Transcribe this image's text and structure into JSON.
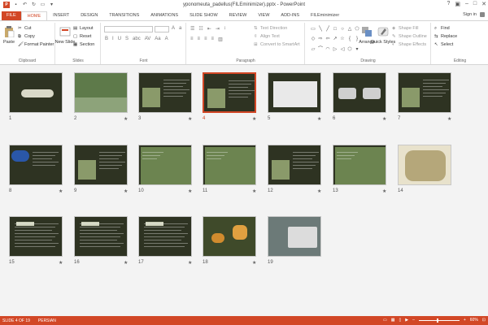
{
  "window": {
    "title": "yponomeuta_padellus(FILEminimizer).pptx - PowerPoint",
    "help": "?"
  },
  "tabs": [
    "FILE",
    "HOME",
    "INSERT",
    "DESIGN",
    "TRANSITIONS",
    "ANIMATIONS",
    "SLIDE SHOW",
    "REVIEW",
    "VIEW",
    "ADD-INS",
    "FILEminimizer"
  ],
  "signin": "Sign in",
  "ribbon": {
    "clipboard": {
      "label": "Clipboard",
      "paste": "Paste",
      "cut": "Cut",
      "copy": "Copy",
      "format_painter": "Format Painter"
    },
    "slides": {
      "label": "Slides",
      "new_slide": "New Slide",
      "layout": "Layout",
      "reset": "Reset",
      "section": "Section"
    },
    "font": {
      "label": "Font"
    },
    "paragraph": {
      "label": "Paragraph",
      "text_direction": "Text Direction",
      "align_text": "Align Text",
      "convert": "Convert to SmartArt"
    },
    "drawing": {
      "label": "Drawing",
      "arrange": "Arrange",
      "quick_styles": "Quick Styles",
      "shape_fill": "Shape Fill",
      "shape_outline": "Shape Outline",
      "shape_effects": "Shape Effects"
    },
    "editing": {
      "label": "Editing",
      "find": "Find",
      "replace": "Replace",
      "select": "Select"
    }
  },
  "slides": [
    {
      "n": "1",
      "star": false,
      "selected": false,
      "kind": "title"
    },
    {
      "n": "2",
      "star": true,
      "selected": false,
      "kind": "photo-lake"
    },
    {
      "n": "3",
      "star": true,
      "selected": false,
      "kind": "text-photo"
    },
    {
      "n": "4",
      "star": true,
      "selected": true,
      "kind": "text-photo"
    },
    {
      "n": "5",
      "star": true,
      "selected": false,
      "kind": "table"
    },
    {
      "n": "6",
      "star": true,
      "selected": false,
      "kind": "moths"
    },
    {
      "n": "7",
      "star": true,
      "selected": false,
      "kind": "text-photo"
    },
    {
      "n": "8",
      "star": true,
      "selected": false,
      "kind": "logo"
    },
    {
      "n": "9",
      "star": true,
      "selected": false,
      "kind": "text-photo"
    },
    {
      "n": "10",
      "star": true,
      "selected": false,
      "kind": "photo"
    },
    {
      "n": "11",
      "star": true,
      "selected": false,
      "kind": "photo"
    },
    {
      "n": "12",
      "star": true,
      "selected": false,
      "kind": "text-photo"
    },
    {
      "n": "13",
      "star": true,
      "selected": false,
      "kind": "photo"
    },
    {
      "n": "14",
      "star": false,
      "selected": false,
      "kind": "illustration"
    },
    {
      "n": "15",
      "star": true,
      "selected": false,
      "kind": "text"
    },
    {
      "n": "16",
      "star": true,
      "selected": false,
      "kind": "text"
    },
    {
      "n": "17",
      "star": true,
      "selected": false,
      "kind": "text"
    },
    {
      "n": "18",
      "star": true,
      "selected": false,
      "kind": "butterflies"
    },
    {
      "n": "19",
      "star": false,
      "selected": false,
      "kind": "laptop"
    }
  ],
  "status": {
    "slide": "SLIDE 4 OF 19",
    "language": "PERSIAN",
    "zoom": "60%"
  },
  "colors": {
    "accent": "#d24726",
    "slide_bg": "#2e3322"
  }
}
